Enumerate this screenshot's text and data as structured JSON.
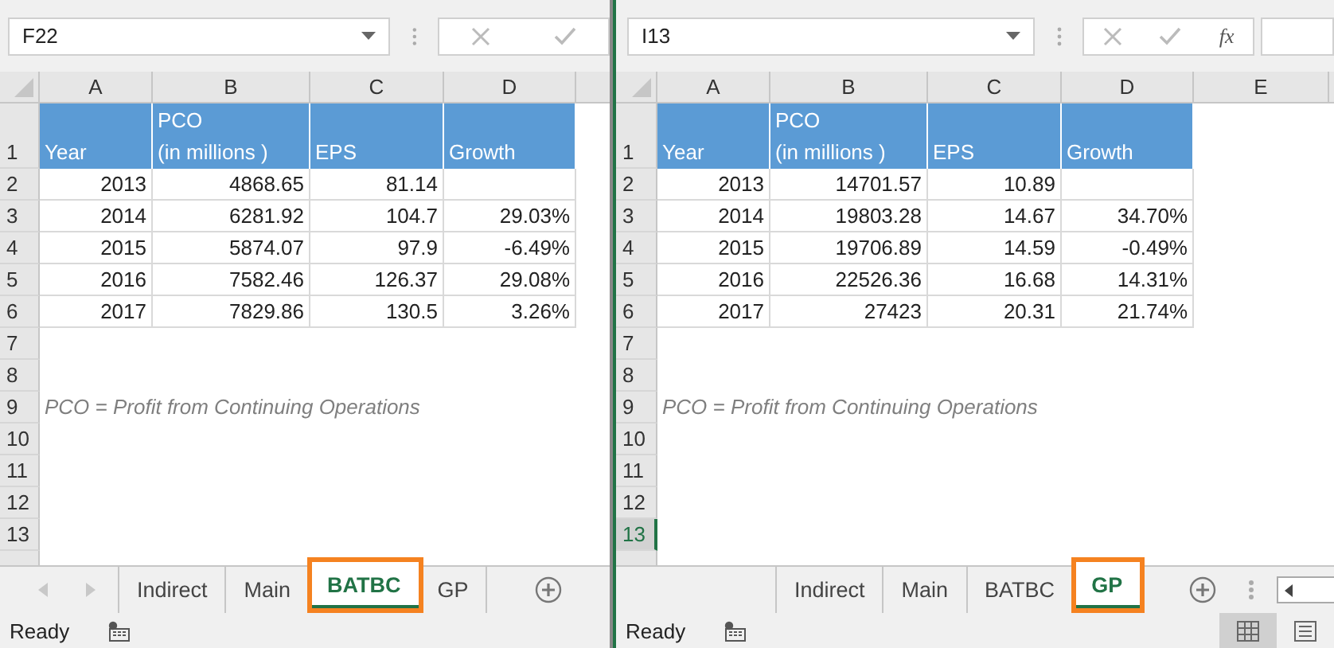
{
  "panes": [
    {
      "name_box": "F22",
      "nav_arrows": true,
      "columns": [
        "A",
        "B",
        "C",
        "D"
      ],
      "rows": [
        {
          "label": "1",
          "selected": false,
          "kind": "header",
          "cells": [
            "Year",
            "PCO\n(in millions )",
            "EPS",
            "Growth"
          ]
        },
        {
          "label": "2",
          "selected": false,
          "kind": "data",
          "cells": [
            "2013",
            "4868.65",
            "81.14",
            ""
          ]
        },
        {
          "label": "3",
          "selected": false,
          "kind": "data",
          "cells": [
            "2014",
            "6281.92",
            "104.7",
            "29.03%"
          ]
        },
        {
          "label": "4",
          "selected": false,
          "kind": "data",
          "cells": [
            "2015",
            "5874.07",
            "97.9",
            "-6.49%"
          ]
        },
        {
          "label": "5",
          "selected": false,
          "kind": "data",
          "cells": [
            "2016",
            "7582.46",
            "126.37",
            "29.08%"
          ]
        },
        {
          "label": "6",
          "selected": false,
          "kind": "data",
          "cells": [
            "2017",
            "7829.86",
            "130.5",
            "3.26%"
          ]
        },
        {
          "label": "7",
          "selected": false,
          "kind": "empty"
        },
        {
          "label": "8",
          "selected": false,
          "kind": "empty"
        },
        {
          "label": "9",
          "selected": false,
          "kind": "note",
          "note": "PCO = Profit from Continuing Operations"
        },
        {
          "label": "10",
          "selected": false,
          "kind": "empty"
        },
        {
          "label": "11",
          "selected": false,
          "kind": "empty"
        },
        {
          "label": "12",
          "selected": false,
          "kind": "empty"
        },
        {
          "label": "13",
          "selected": false,
          "kind": "empty"
        }
      ],
      "tabs": [
        {
          "label": "Indirect",
          "selected": false
        },
        {
          "label": "Main",
          "selected": false
        },
        {
          "label": "BATBC",
          "selected": true
        },
        {
          "label": "GP",
          "selected": false
        }
      ],
      "status": "Ready"
    },
    {
      "name_box": "I13",
      "fx": "fx",
      "nav_arrows": false,
      "view_buttons": [
        {
          "kind": "normal",
          "selected": true
        },
        {
          "kind": "page-layout",
          "selected": false
        }
      ],
      "columns": [
        "A",
        "B",
        "C",
        "D",
        "E"
      ],
      "rows": [
        {
          "label": "1",
          "selected": false,
          "kind": "header",
          "cells": [
            "Year",
            "PCO\n(in millions )",
            "EPS",
            "Growth"
          ]
        },
        {
          "label": "2",
          "selected": false,
          "kind": "data",
          "cells": [
            "2013",
            "14701.57",
            "10.89",
            ""
          ]
        },
        {
          "label": "3",
          "selected": false,
          "kind": "data",
          "cells": [
            "2014",
            "19803.28",
            "14.67",
            "34.70%"
          ]
        },
        {
          "label": "4",
          "selected": false,
          "kind": "data",
          "cells": [
            "2015",
            "19706.89",
            "14.59",
            "-0.49%"
          ]
        },
        {
          "label": "5",
          "selected": false,
          "kind": "data",
          "cells": [
            "2016",
            "22526.36",
            "16.68",
            "14.31%"
          ]
        },
        {
          "label": "6",
          "selected": false,
          "kind": "data",
          "cells": [
            "2017",
            "27423",
            "20.31",
            "21.74%"
          ]
        },
        {
          "label": "7",
          "selected": false,
          "kind": "empty"
        },
        {
          "label": "8",
          "selected": false,
          "kind": "empty"
        },
        {
          "label": "9",
          "selected": false,
          "kind": "note",
          "note": "PCO = Profit from Continuing Operations"
        },
        {
          "label": "10",
          "selected": false,
          "kind": "empty"
        },
        {
          "label": "11",
          "selected": false,
          "kind": "empty"
        },
        {
          "label": "12",
          "selected": false,
          "kind": "empty"
        },
        {
          "label": "13",
          "selected": true,
          "kind": "empty"
        }
      ],
      "tabs": [
        {
          "label": "Indirect",
          "selected": false
        },
        {
          "label": "Main",
          "selected": false
        },
        {
          "label": "BATBC",
          "selected": false
        },
        {
          "label": "GP",
          "selected": true
        }
      ],
      "status": "Ready"
    }
  ]
}
